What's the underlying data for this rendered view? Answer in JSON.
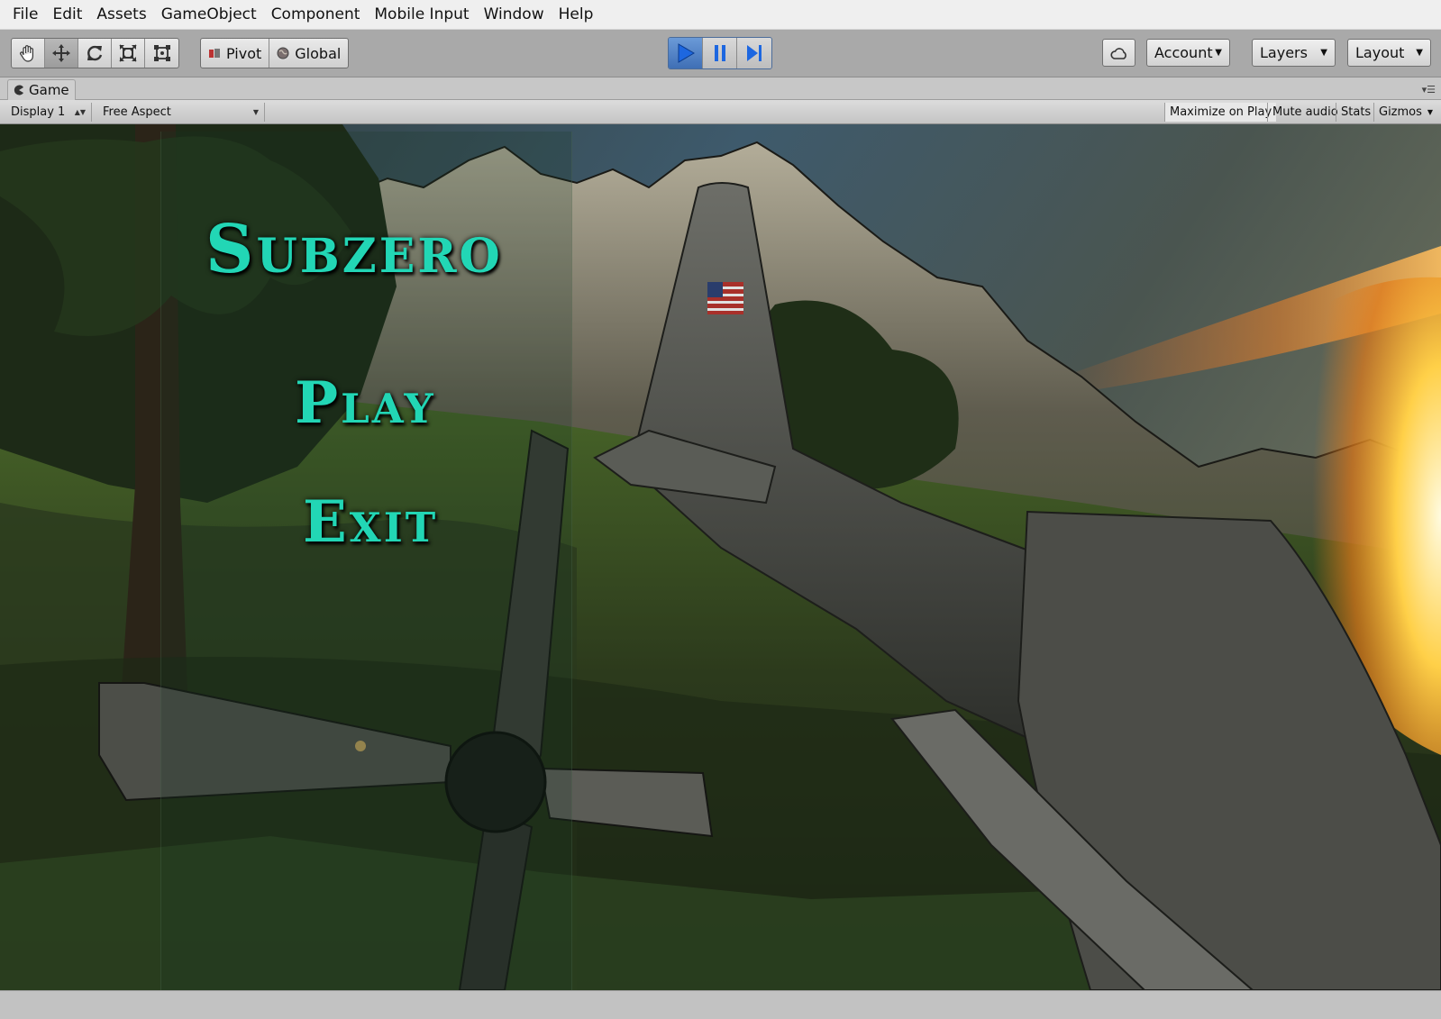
{
  "menubar": {
    "items": [
      "File",
      "Edit",
      "Assets",
      "GameObject",
      "Component",
      "Mobile Input",
      "Window",
      "Help"
    ]
  },
  "toolbar": {
    "transform_tools": [
      "hand-icon",
      "move-icon",
      "rotate-icon",
      "scale-icon",
      "rect-transform-icon"
    ],
    "pivot_label": "Pivot",
    "global_label": "Global",
    "playback": [
      "play-icon",
      "pause-icon",
      "step-icon"
    ],
    "account_label": "Account",
    "layers_label": "Layers",
    "layout_label": "Layout"
  },
  "game_tab": {
    "title": "Game",
    "display": "Display 1",
    "aspect": "Free Aspect",
    "maximize_on_play": "Maximize on Play",
    "mute_audio": "Mute audio",
    "stats": "Stats",
    "gizmos": "Gizmos"
  },
  "game": {
    "title": "Subzero",
    "options": [
      "Play",
      "Exit"
    ]
  },
  "colors": {
    "title_teal": "#22d6b5",
    "play_active": "#3f6fb5",
    "editor_gray": "#a9a9a9"
  }
}
